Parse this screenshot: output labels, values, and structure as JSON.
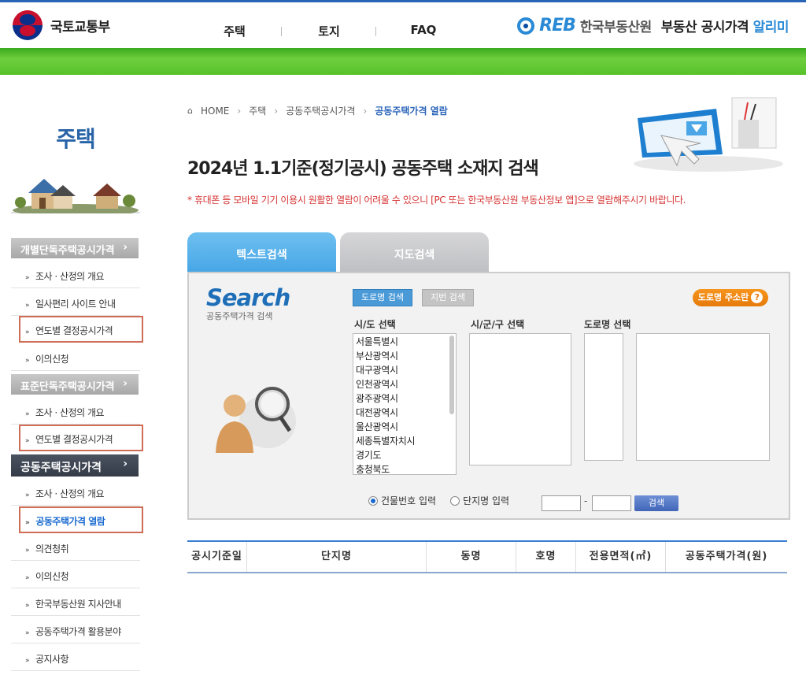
{
  "header": {
    "ministry": "국토교통부",
    "nav": [
      "주택",
      "토지",
      "FAQ"
    ],
    "reb_org": "한국부동산원",
    "service_main": "부동산 공시가격",
    "service_accent": "알리미",
    "reb_logo_text": "REB"
  },
  "sidebar": {
    "title": "주택",
    "sections": [
      {
        "label": "개별단독주택공시가격",
        "items": [
          "조사 · 산정의 개요",
          "일사편리 사이트 안내",
          "연도별 결정공시가격",
          "이의신청"
        ]
      },
      {
        "label": "표준단독주택공시가격",
        "items": [
          "조사 · 산정의 개요",
          "연도별 결정공시가격"
        ]
      },
      {
        "label": "공동주택공시가격",
        "items": [
          "조사 · 산정의 개요",
          "공동주택가격 열람",
          "의견청취",
          "이의신청",
          "한국부동산원 지사안내",
          "공동주택가격 활용분야",
          "공지사항"
        ]
      }
    ]
  },
  "breadcrumb": [
    "HOME",
    "주택",
    "공동주택공시가격",
    "공동주택가격 열람"
  ],
  "page_title": "2024년 1.1기준(정기공시) 공동주택 소재지 검색",
  "notice": "* 휴대폰 등 모바일 기기 이용시 원활한 열람이 어려울 수 있으니 [PC 또는 한국부동산원 부동산정보 앱]으로 열람해주시기 바랍니다.",
  "tabs": [
    "텍스트검색",
    "지도검색"
  ],
  "search": {
    "logo_big": "Search",
    "logo_small": "공동주택가격 검색",
    "road_btn": "도로명 검색",
    "lot_btn": "지번 검색",
    "addr_help": "도로명 주소란",
    "labels": [
      "시/도 선택",
      "시/군/구 선택",
      "도로명 선택"
    ],
    "sido": [
      "서울특별시",
      "부산광역시",
      "대구광역시",
      "인천광역시",
      "광주광역시",
      "대전광역시",
      "울산광역시",
      "세종특별자치시",
      "경기도",
      "충청북도"
    ],
    "radio_building": "건물번호 입력",
    "radio_complex": "단지명 입력",
    "dash": "-",
    "search_btn": "검색"
  },
  "table_headers": [
    "공시기준일",
    "단지명",
    "동명",
    "호명",
    "전용면적(㎡)",
    "공동주택가격(원)"
  ]
}
